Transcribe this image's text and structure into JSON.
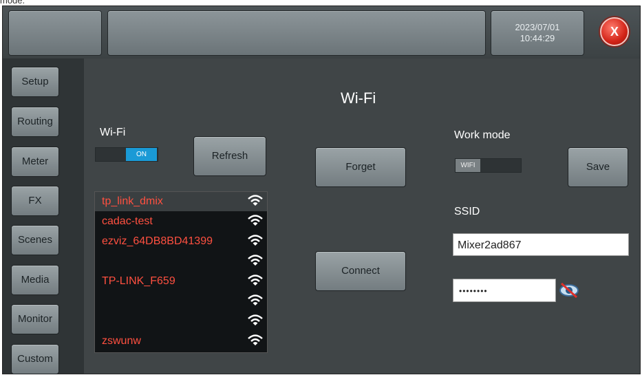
{
  "caption": "mode.",
  "header": {
    "date": "2023/07/01",
    "time": "10:44:29",
    "close_label": "X"
  },
  "sidebar": {
    "items": [
      {
        "label": "Setup"
      },
      {
        "label": "Routing"
      },
      {
        "label": "Meter"
      },
      {
        "label": "FX"
      },
      {
        "label": "Scenes"
      },
      {
        "label": "Media"
      },
      {
        "label": "Monitor"
      },
      {
        "label": "Custom"
      }
    ]
  },
  "page": {
    "title": "Wi-Fi",
    "wifi_label": "Wi-Fi",
    "wifi_toggle": "ON",
    "refresh": "Refresh",
    "forget": "Forget",
    "connect": "Connect",
    "work_mode_label": "Work mode",
    "work_mode_value": "WIFI",
    "save": "Save",
    "ssid_label": "SSID",
    "ssid_value": "Mixer2ad867",
    "password_value": "••••••••"
  },
  "networks": [
    {
      "name": "tp_link_dmix",
      "selected": true
    },
    {
      "name": "cadac-test",
      "selected": false
    },
    {
      "name": "ezviz_64DB8BD41399",
      "selected": false
    },
    {
      "name": "",
      "selected": false
    },
    {
      "name": "TP-LINK_F659",
      "selected": false
    },
    {
      "name": "",
      "selected": false
    },
    {
      "name": "",
      "selected": false
    },
    {
      "name": "zswunw",
      "selected": false
    }
  ],
  "colors": {
    "accent": "#1a9ad6",
    "network_text": "#ff5040",
    "close": "#d32418"
  }
}
